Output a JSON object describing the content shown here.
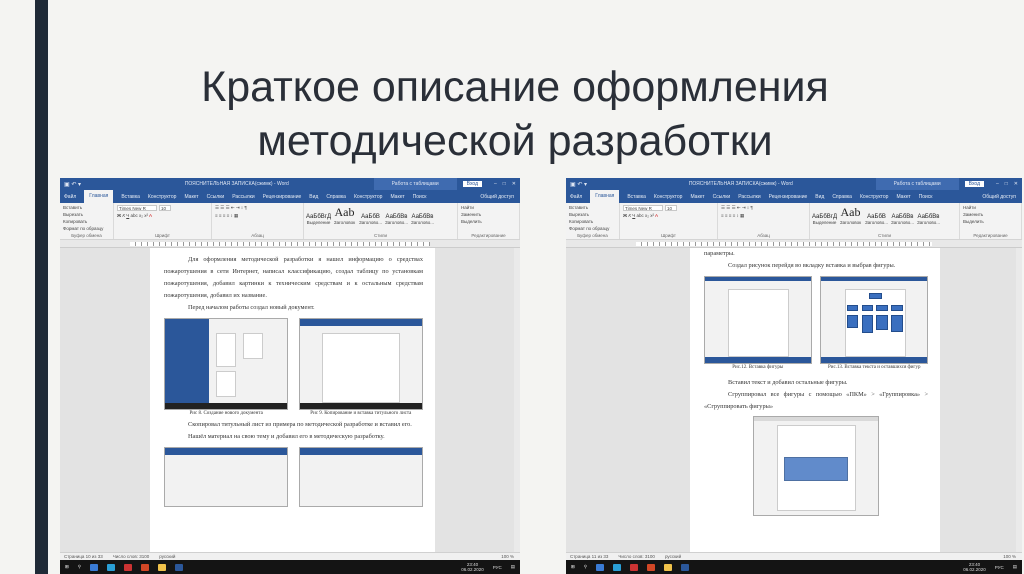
{
  "slide": {
    "title": "Краткое описание оформления методической разработки",
    "accent_color": "#1f2a37"
  },
  "word_common": {
    "doc_title": "ПОЯСНИТЕЛЬНАЯ ЗАПИСКА(сжимк) - Word",
    "context_title": "Работа с таблицами",
    "login": "Вход",
    "tabs": [
      "Файл",
      "Главная",
      "Вставка",
      "Конструктор",
      "Макет",
      "Ссылки",
      "Рассылки",
      "Рецензирование",
      "Вид",
      "Справка",
      "Конструктор",
      "Макет",
      "Поиск"
    ],
    "share": "Общий доступ",
    "clipboard": {
      "paste": "Вставить",
      "cut": "Вырезать",
      "copy": "Копировать",
      "format_painter": "Формат по образцу",
      "label": "Буфер обмена"
    },
    "font": {
      "name": "Times New R",
      "size": "10",
      "label": "Шрифт"
    },
    "paragraph": {
      "label": "Абзац"
    },
    "styles": {
      "label": "Стили",
      "items": [
        {
          "sample": "АаБбВгД",
          "name": "Выделение"
        },
        {
          "sample": "Aab",
          "name": "Заголовок"
        },
        {
          "sample": "АаБбВ",
          "name": "Заголово..."
        },
        {
          "sample": "АаБбВв",
          "name": "Заголово..."
        },
        {
          "sample": "АаБбВв",
          "name": "Заголово..."
        }
      ]
    },
    "editing": {
      "find": "Найти",
      "replace": "Заменить",
      "select": "Выделить",
      "label": "Редактирование"
    },
    "status_words": "Число слов: 3100",
    "status_lang": "русский",
    "zoom": "100 %",
    "tray_lang": "РУС",
    "time": "23:40",
    "date": "06.02.2020"
  },
  "left_doc": {
    "status_page": "Страница 10 из 33",
    "para1": "Для оформления методической разработки я нашел информацию о средствах пожаротушения в сети Интернет, написал классификацию, создал таблицу по установкам пожаротушения, добавил картинки к техническим средствам и к остальным средствам пожаротушения, добавил их название.",
    "para2": "Перед началом работы создал новый документ.",
    "fig8": "Рис 8. Создание нового документа",
    "fig9": "Рис 9. Копирование и вставка титульного листа",
    "para3": "Скопировал титульный лист из примера по методической разработке и вставил его.",
    "para4": "Нашёл материал на свою тему и добавил его в методическую разработку."
  },
  "right_doc": {
    "status_page": "Страница 11 из 33",
    "para0": "параметры.",
    "para1": "Создал рисунок перейдя во вкладку вставка и выбрав фигуры.",
    "fig12": "Рис.12. Вставка фигуры",
    "fig13": "Рис.13. Вставка текста и оставшихся фигур",
    "para2": "Вставил текст и добавил остальные фигуры.",
    "para3": "Сгруппировал все фигуры с помощью «ПКМ» > «Группировка» > «Сгруппировать фигуры»"
  }
}
